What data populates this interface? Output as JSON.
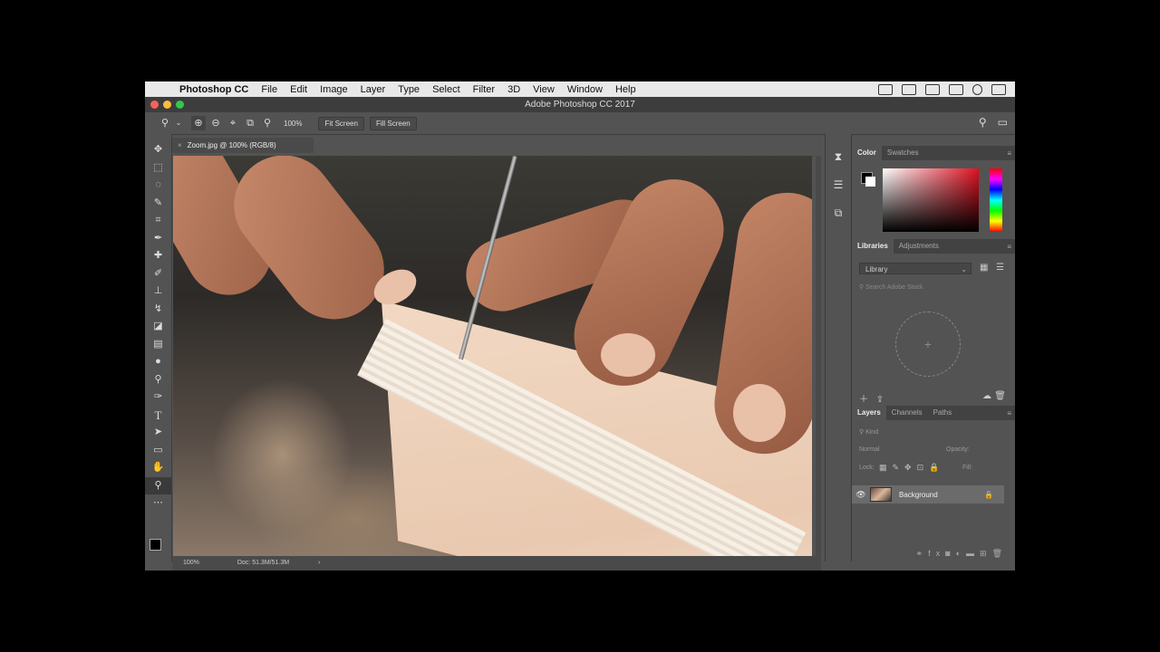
{
  "menubar": {
    "app_name": "Photoshop CC",
    "items": [
      "File",
      "Edit",
      "Image",
      "Layer",
      "Type",
      "Select",
      "Filter",
      "3D",
      "View",
      "Window",
      "Help"
    ]
  },
  "window": {
    "title": "Adobe Photoshop CC 2017"
  },
  "options_bar": {
    "zoom_value": "100%",
    "fit_screen_label": "Fit Screen",
    "fill_screen_label": "Fill Screen"
  },
  "document": {
    "tab_title": "Zoom.jpg @ 100% (RGB/8)",
    "status_zoom": "100%",
    "status_doc": "Doc: 51.3M/51.3M"
  },
  "panels": {
    "color_tabs": [
      "Color",
      "Swatches"
    ],
    "library_tabs": [
      "Libraries",
      "Adjustments"
    ],
    "library_select": "Library",
    "library_search_placeholder": "Search Adobe Stock",
    "layers_tabs": [
      "Layers",
      "Channels",
      "Paths"
    ],
    "layers_kind_placeholder": "Kind",
    "blend_mode": "Normal",
    "opacity_label": "Opacity:",
    "lock_label": "Lock:",
    "fill_label": "Fill:",
    "layer_name": "Background"
  },
  "colors": {
    "foreground": "#000000",
    "background": "#ffffff",
    "ui_panel": "#535353"
  }
}
